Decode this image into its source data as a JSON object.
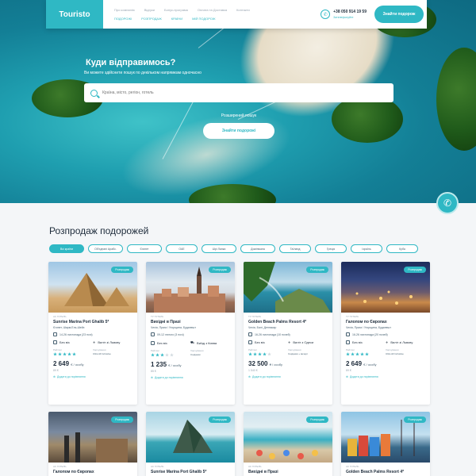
{
  "header": {
    "logo": "Touristo",
    "nav_top": [
      "Про компанію",
      "Відгуки",
      "Бонус-програма",
      "Оплата та Доставка",
      "Контакти"
    ],
    "nav_bottom": [
      "ПОДОРОЖІ",
      "РОЗПРОДАЖ",
      "КРАЇНИ",
      "МІЙ ПОДОРОЖ"
    ],
    "phone": "+38 050 914 19 59",
    "phone_sub": "Зателефонуйте",
    "cta": "Знайти подорож"
  },
  "hero": {
    "title": "Куди відправимось?",
    "subtitle": "Ви можете здійснити пошук по декільком напрямкам одночасно",
    "search_placeholder": "Країна, місто, регіон, готель",
    "advanced_search": "Розширений пошук",
    "button": "Знайти подорожі"
  },
  "sales": {
    "title": "Розпродаж подорожей",
    "filters": [
      "Всі країни",
      "Об'єднані Арабс.",
      "Єгипет",
      "ОАЕ",
      "Шрі Ланка",
      "Домінікана",
      "Таїланд",
      "Греція",
      "Ізраїль",
      "Куба"
    ],
    "active_filter": 0
  },
  "cards": [
    {
      "badge": "Розпродаж",
      "small": "АС ГОТЕЛЬ",
      "name": "Sunrise Marina Port Ghalib 5*",
      "location": "Єгипет, Шарм-Ель-Шейх",
      "dates": "14-26 листопада (23 ночі)",
      "excursion": "Без віз",
      "flight": "Виліт зі Львову",
      "rating_label": "Рейтинг",
      "meals_label": "Харчування",
      "meals": "Ultra All Inclusive",
      "stars": 5,
      "price": "2 649",
      "per": "€ / особу",
      "old_price": "89 €",
      "compare": "Додати до порівняння"
    },
    {
      "badge": "Розпродаж",
      "small": "ТУ ГОТЕЛЬ",
      "name": "Вихідні в Празі",
      "location": "Чехія, Прага / Угорщина, Будапешт",
      "dates": "09-12 лютого (3 ночі)",
      "excursion": "Без віз",
      "flight": "Виїзд з Києва",
      "rating_label": "Рейтинг",
      "meals_label": "Харчування",
      "meals": "Сніданки",
      "stars": 3,
      "price": "1 235",
      "per": "€ / особу",
      "old_price": "85 €",
      "compare": "Додати до порівняння"
    },
    {
      "badge": "Розпродаж",
      "small": "ТУ ГОТЕЛЬ",
      "name": "Golden Beach Palms Resort 4*",
      "location": "Чехія, Балі, Денпасар",
      "dates": "16-26 листопада (10 ночей)",
      "excursion": "Без віз",
      "flight": "Виліт з Одеси",
      "rating_label": "Рейтинг",
      "meals_label": "Харчування",
      "meals": "Сніданки + вечері",
      "stars": 4,
      "price": "32 500",
      "per": "₴ / особу",
      "old_price": "1 540 €",
      "compare": "Додати до порівняння"
    },
    {
      "badge": "Розпродаж",
      "small": "ТУ ГОТЕЛЬ",
      "name": "Галопом по Європах",
      "location": "Чехія, Прага / Угорщина, Будапешт",
      "dates": "16-26 листопада (20 ночей)",
      "excursion": "Без віз",
      "flight": "Виліт зі Львову",
      "rating_label": "Рейтинг",
      "meals_label": "Харчування",
      "meals": "Ultra All Inclusive",
      "stars": 5,
      "price": "2 649",
      "per": "€ / особу",
      "old_price": "89 €",
      "compare": "Додати до порівняння"
    },
    {
      "badge": "Розпродаж",
      "small": "АС ГОТЕЛЬ",
      "name": "Галопом по Європах"
    },
    {
      "badge": "Розпродаж",
      "small": "АС ГОТЕЛЬ",
      "name": "Sunrise Marina Port Ghalib 5*"
    },
    {
      "badge": "Розпродаж",
      "small": "АС ГОТЕЛЬ",
      "name": "Вихідні в Празі"
    },
    {
      "badge": "Розпродаж",
      "small": "АС ГОТЕЛЬ",
      "name": "Golden Beach Palms Resort 4*"
    }
  ],
  "colors": {
    "accent": "#2fb8c4",
    "text": "#1d2b3a",
    "muted": "#9aa6b2"
  },
  "icons": {
    "search": "search-icon",
    "phone": "phone-icon",
    "callback": "callback-phone-icon"
  }
}
